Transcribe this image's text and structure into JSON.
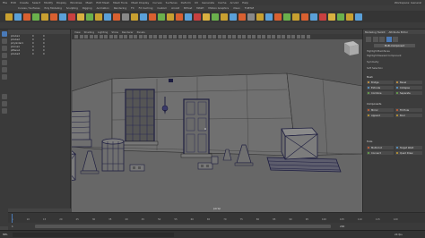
{
  "menubar": {
    "items": [
      "File",
      "Edit",
      "Create",
      "Select",
      "Modify",
      "Display",
      "Windows",
      "Mesh",
      "Edit Mesh",
      "Mesh Tools",
      "Mesh Display",
      "Curves",
      "Surfaces",
      "Deform",
      "UV",
      "Generate",
      "Cache",
      "Arnold",
      "Help"
    ],
    "workspace": "Workspace: General"
  },
  "shelf_tabs": [
    "Curves / Surfaces",
    "Poly Modeling",
    "Sculpting",
    "Rigging",
    "Animation",
    "Rendering",
    "FX",
    "FX Caching",
    "Custom",
    "Arnold",
    "Bifrost",
    "MASH",
    "Motion Graphics",
    "XGen",
    "TURTLE"
  ],
  "shelf_colors": [
    "#c8a030",
    "#5aa0d8",
    "#d86030",
    "#6ab04c",
    "#c8a030",
    "#d86030",
    "#5aa0d8",
    "#c84040",
    "#d8b040",
    "#6ab04c",
    "#c8a030",
    "#5aa0d8",
    "#d86030",
    "#888888"
  ],
  "outliner": {
    "rows": [
      [
        "pCube1",
        "0",
        "0"
      ],
      [
        "pCube2",
        "0",
        "0"
      ],
      [
        "pCylinder1",
        "0",
        "0"
      ],
      [
        "pCone1",
        "0",
        "0"
      ],
      [
        "pPlane1",
        "0",
        "0"
      ],
      [
        "pCube3",
        "0",
        "0"
      ]
    ]
  },
  "viewport": {
    "menu": [
      "View",
      "Shading",
      "Lighting",
      "Show",
      "Renderer",
      "Panels"
    ],
    "camera": "persp"
  },
  "rightpanel": {
    "tabs": [
      "Modeling Toolkit",
      "Attribute Editor"
    ],
    "mode": "Multi-Component",
    "buttons": [
      "Bridge",
      "Bevel",
      "Extrude",
      "Collapse",
      "Combine",
      "Separate",
      "Mirror",
      "Fill Hole",
      "Append",
      "Bool",
      "Multi-Cut",
      "Target Weld",
      "Connect",
      "Quad Draw"
    ],
    "labels": [
      "Highlight Backfaces",
      "Highlight Nearest Component",
      "Symmetry",
      "Soft Selection",
      "Mesh",
      "Components",
      "Tools"
    ]
  },
  "timeline": {
    "start": "1",
    "end": "120",
    "ticks": [
      "5",
      "10",
      "15",
      "20",
      "25",
      "30",
      "35",
      "40",
      "45",
      "50",
      "55",
      "60",
      "65",
      "70",
      "75",
      "80",
      "85",
      "90",
      "95",
      "100",
      "105",
      "110",
      "115",
      "120"
    ]
  },
  "range": {
    "start": "1",
    "end": "200",
    "current": "1"
  },
  "cmdline": {
    "label": "MEL",
    "fps": "24 fps"
  }
}
